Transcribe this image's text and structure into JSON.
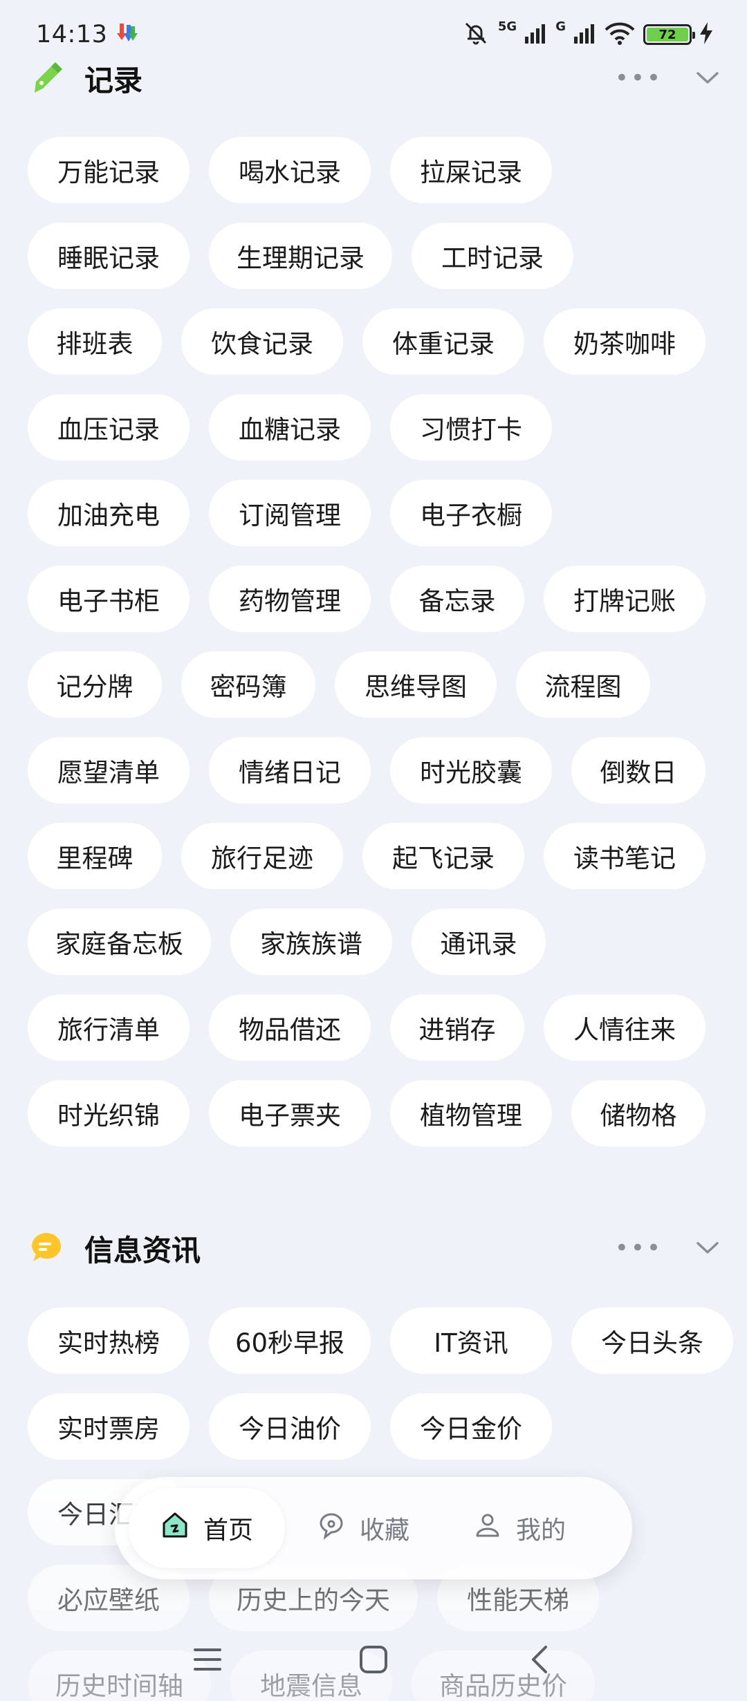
{
  "status_bar": {
    "time": "14:13",
    "network_1": "5G",
    "network_2": "G",
    "battery_level": "72"
  },
  "sections": [
    {
      "title": "记录",
      "more": "•••",
      "rows": [
        [
          "万能记录",
          "喝水记录",
          "拉屎记录"
        ],
        [
          "睡眠记录",
          "生理期记录",
          "工时记录"
        ],
        [
          "排班表",
          "饮食记录",
          "体重记录",
          "奶茶咖啡"
        ],
        [
          "血压记录",
          "血糖记录",
          "习惯打卡"
        ],
        [
          "加油充电",
          "订阅管理",
          "电子衣橱"
        ],
        [
          "电子书柜",
          "药物管理",
          "备忘录",
          "打牌记账"
        ],
        [
          "记分牌",
          "密码簿",
          "思维导图",
          "流程图"
        ],
        [
          "愿望清单",
          "情绪日记",
          "时光胶囊",
          "倒数日"
        ],
        [
          "里程碑",
          "旅行足迹",
          "起飞记录",
          "读书笔记"
        ],
        [
          "家庭备忘板",
          "家族族谱",
          "通讯录"
        ],
        [
          "旅行清单",
          "物品借还",
          "进销存",
          "人情往来"
        ],
        [
          "时光织锦",
          "电子票夹",
          "植物管理",
          "储物格"
        ]
      ]
    },
    {
      "title": "信息资讯",
      "more": "•••",
      "rows": [
        [
          "实时热榜",
          "60秒早报",
          "IT资讯",
          "今日头条"
        ],
        [
          "实时票房",
          "今日油价",
          "今日金价"
        ],
        [
          "今日汇率",
          "",
          ""
        ],
        [
          "必应壁纸",
          "历史上的今天",
          "性能天梯"
        ],
        [
          "历史时间轴",
          "地震信息",
          "商品历史价"
        ]
      ]
    }
  ],
  "tab_bar": {
    "tabs": [
      {
        "label": "首页",
        "icon": "home-icon",
        "active": true
      },
      {
        "label": "收藏",
        "icon": "favorites-icon",
        "active": false
      },
      {
        "label": "我的",
        "icon": "profile-icon",
        "active": false
      }
    ]
  },
  "nav_bar": {
    "buttons": [
      "menu-icon",
      "home-square-icon",
      "back-icon"
    ]
  },
  "colors": {
    "background": "#eff2f8",
    "chip": "#ffffff",
    "record_icon": "#7bd44a",
    "news_icon": "#ffc52a",
    "battery": "#6fcf4c"
  }
}
